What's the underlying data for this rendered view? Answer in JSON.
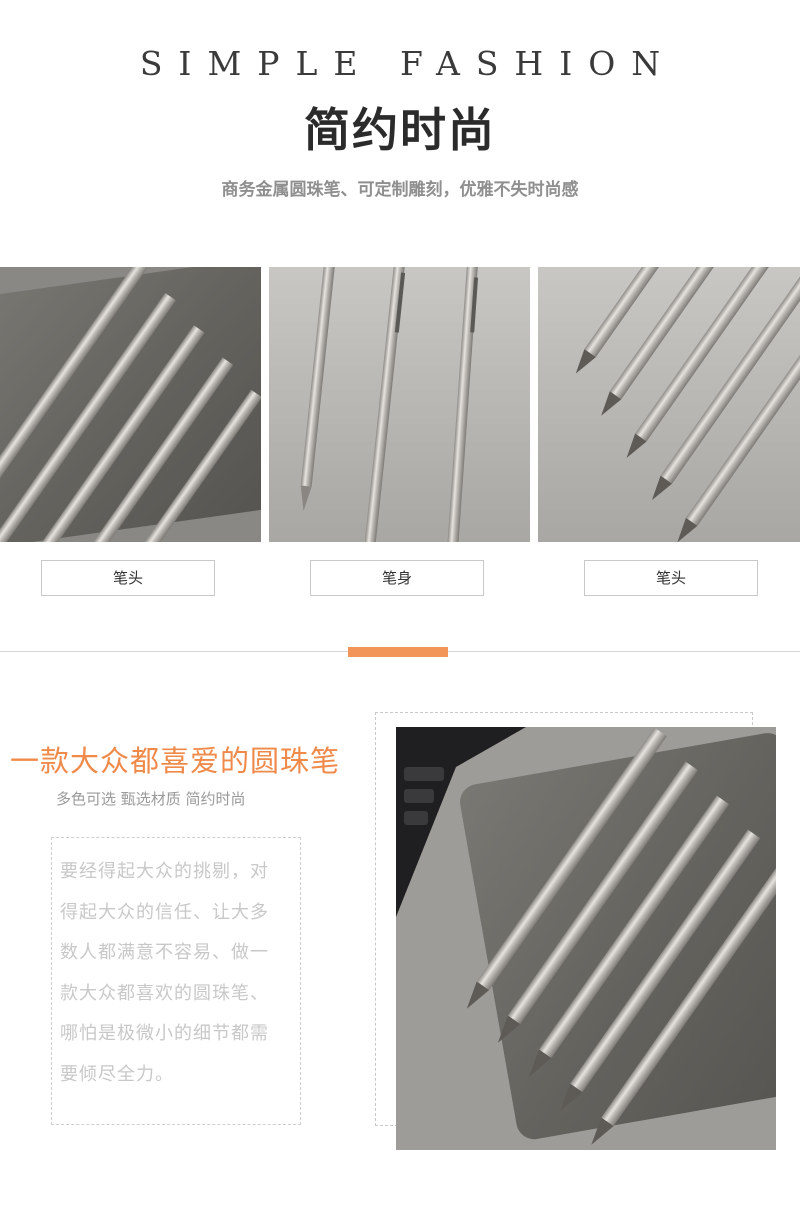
{
  "header": {
    "title_en": "SIMPLE FASHION",
    "title_cn": "简约时尚",
    "subtitle": "商务金属圆珠笔、可定制雕刻，优雅不失时尚感"
  },
  "gallery": [
    {
      "label": "笔头"
    },
    {
      "label": "笔身"
    },
    {
      "label": "笔头"
    }
  ],
  "feature": {
    "headline": "一款大众都喜爱的圆珠笔",
    "tags": "多色可选  甄选材质  简约时尚",
    "lines": [
      "要经得起大众的挑剔，对",
      "得起大众的信任、让大多",
      "数人都满意不容易、做一",
      "款大众都喜欢的圆珠笔、",
      "哪怕是极微小的细节都需",
      "要倾尽全力。"
    ]
  },
  "colors": {
    "accent": "#f29559",
    "headline": "#f08a4a",
    "pen_silver": "#c9c6c2",
    "notebook": "#6b6964"
  }
}
